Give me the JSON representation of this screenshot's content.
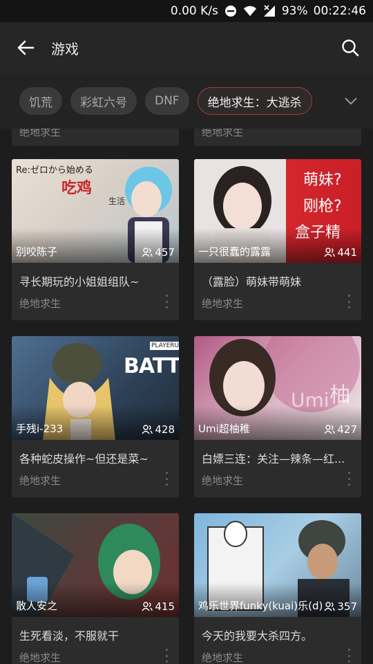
{
  "status": {
    "speed": "0.00 K/s",
    "battery": "93%",
    "time": "00:22:46",
    "icons": [
      "do-not-disturb-icon",
      "wifi-icon",
      "signal-off-icon"
    ]
  },
  "appbar": {
    "title": "游戏",
    "back_icon": "arrow-back-icon",
    "search_icon": "search-icon"
  },
  "chips": [
    {
      "label": "饥荒",
      "active": false
    },
    {
      "label": "彩虹六号",
      "active": false
    },
    {
      "label": "DNF",
      "active": false
    },
    {
      "label": "绝地求生：大逃杀",
      "active": true
    }
  ],
  "top_partial": {
    "category_left": "绝地求生",
    "category_right": "绝地求生"
  },
  "cards": [
    {
      "streamer": "别咬陈子",
      "viewers": "457",
      "title": "寻长期玩的小姐姐组队~",
      "category": "绝地求生",
      "thumb_texts": [
        "Re:ゼロから始める",
        "吃鸡",
        "生活"
      ]
    },
    {
      "streamer": "一只很蠢的露露",
      "viewers": "441",
      "title": "（露脸）萌妹带萌妹",
      "category": "绝地求生",
      "thumb_texts": [
        "萌妹?",
        "刚枪?",
        "盒子精"
      ]
    },
    {
      "streamer": "手残i-233",
      "viewers": "428",
      "title": "各种蛇皮操作~但还是菜~",
      "category": "绝地求生",
      "thumb_texts": [
        "PLAYERUN",
        "BATTLEG"
      ]
    },
    {
      "streamer": "Umi超柚稚",
      "viewers": "427",
      "title": "白嫖三连：关注—辣条—红...",
      "category": "绝地求生",
      "thumb_texts": [
        "Umi",
        "柚"
      ]
    },
    {
      "streamer": "散人安之",
      "viewers": "415",
      "title": "生死看淡，不服就干",
      "category": "绝地求生",
      "thumb_texts": []
    },
    {
      "streamer": "鸡乐世界funky(kuai)乐(d)",
      "viewers": "357",
      "title": "今天的我要大杀四方。",
      "category": "绝地求生",
      "thumb_texts": []
    }
  ],
  "colors": {
    "background": "#1d1d1d",
    "card": "#2c2c2c",
    "chip_active_border": "#a53c3c",
    "appbar": "#262626"
  }
}
